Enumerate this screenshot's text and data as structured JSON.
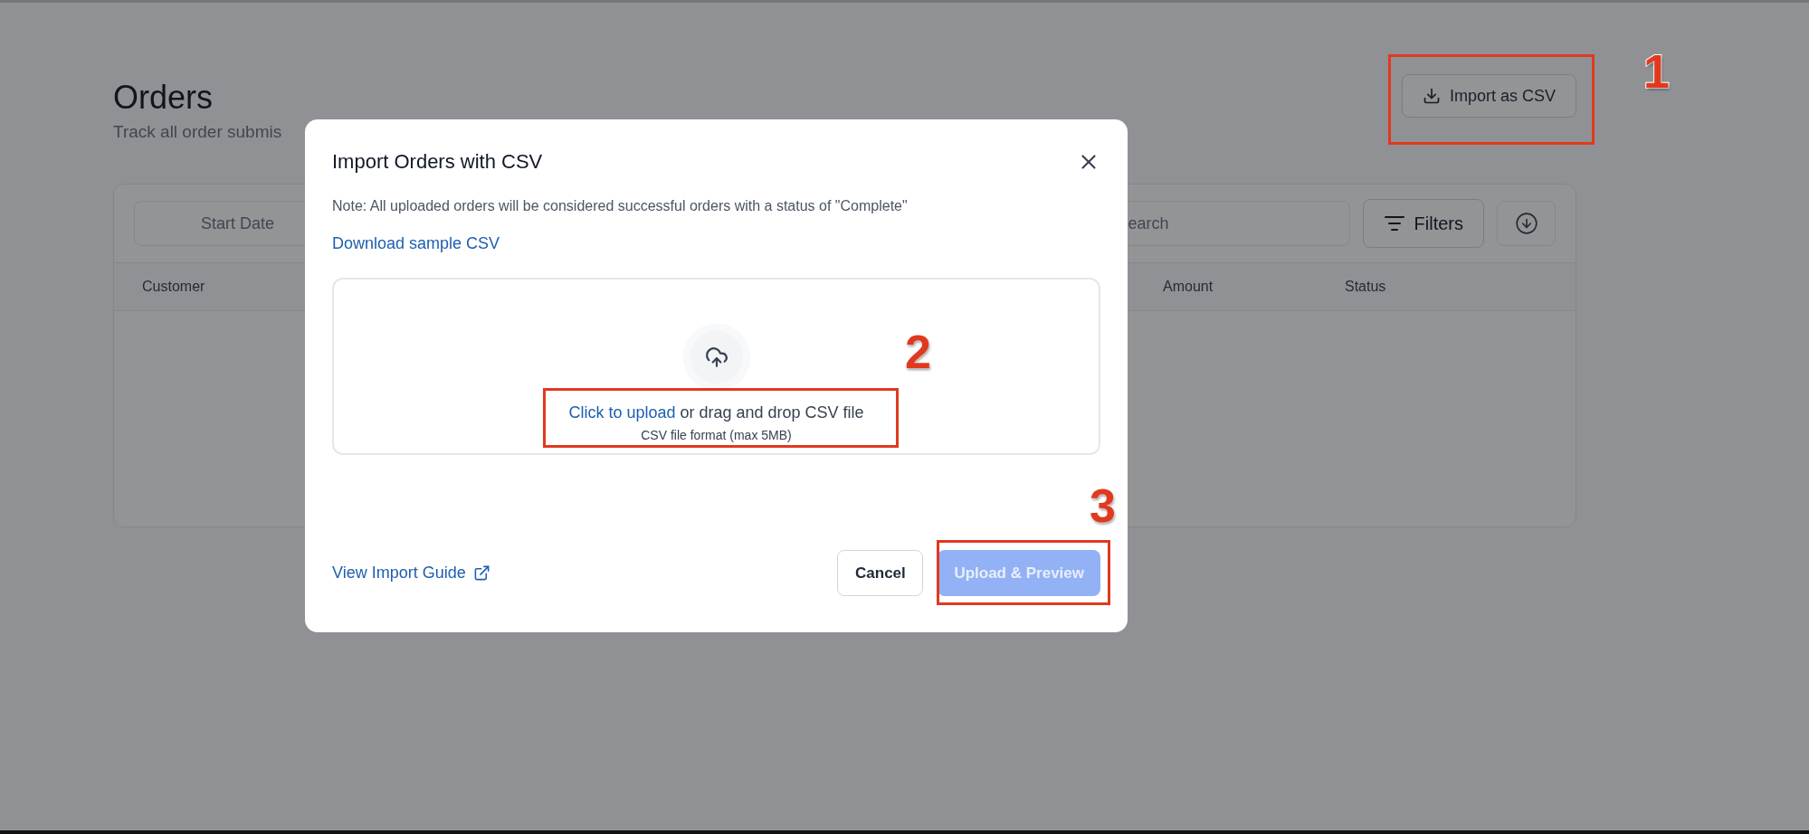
{
  "page": {
    "title": "Orders",
    "subtitle": "Track all order submis",
    "import_button": "Import as CSV"
  },
  "toolbar": {
    "start_date_placeholder": "Start Date",
    "search_placeholder": "earch",
    "filters_button": "Filters"
  },
  "table": {
    "columns": [
      "Customer",
      "Amount",
      "Status"
    ]
  },
  "dialog": {
    "title": "Import Orders with CSV",
    "note": "Note: All uploaded orders will be considered successful orders with a status of \"Complete\"",
    "sample_link": "Download sample CSV",
    "dropzone": {
      "link": "Click to upload",
      "text": "or drag and drop CSV file",
      "hint": "CSV file format (max 5MB)"
    },
    "guide_link": "View Import Guide",
    "buttons": [
      {
        "label": "Cancel",
        "kind": "secondary",
        "disabled": false
      },
      {
        "label": "Upload & Preview",
        "kind": "primary",
        "disabled": true
      }
    ]
  },
  "annotations": [
    {
      "label": "1"
    },
    {
      "label": "2"
    },
    {
      "label": "3"
    }
  ]
}
